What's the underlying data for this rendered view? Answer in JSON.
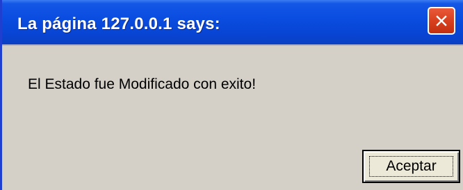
{
  "dialog": {
    "title": "La página 127.0.0.1 says:",
    "close_icon": "close-x-icon",
    "message": "El Estado fue Modificado con exito!",
    "ok_label": "Aceptar"
  },
  "colors": {
    "titlebar": "#0a4de0",
    "body": "#d4d0c8",
    "close_button": "#d8401e"
  }
}
